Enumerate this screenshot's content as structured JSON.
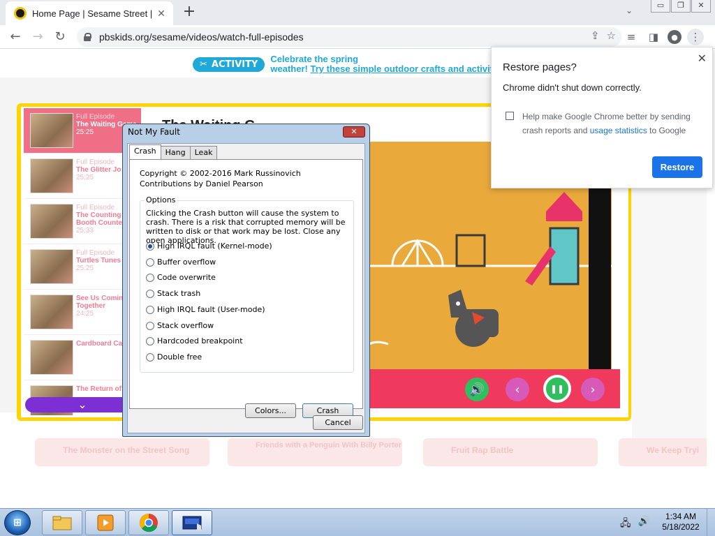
{
  "browser": {
    "tab_title": "Home Page | Sesame Street | PBS",
    "tab_close": "✕",
    "new_tab": "+",
    "tab_menu": "⌄",
    "url": "pbskids.org/sesame/videos/watch-full-episodes",
    "window_buttons": [
      "▭",
      "❐",
      "✕"
    ]
  },
  "banner": {
    "pill": "ACTIVITY",
    "line1": "Celebrate the spring",
    "line2_prefix": "weather!",
    "line2_link": "Try these simple outdoor crafts and activiti"
  },
  "player": {
    "title": "The Waiting G",
    "playlist": [
      {
        "ep": "Full Episode",
        "name": "The Waiting Game",
        "dur": "25:25",
        "active": true
      },
      {
        "ep": "Full Episode",
        "name": "The Glitter Jo",
        "dur": "25:25",
        "active": false
      },
      {
        "ep": "Full Episode",
        "name": "The Counting Booth Counte",
        "dur": "25:33",
        "active": false
      },
      {
        "ep": "Full Episode",
        "name": "Turtles Tunes",
        "dur": "25:25",
        "active": false
      },
      {
        "ep": "",
        "name": "See Us Comin Together",
        "dur": "24:25",
        "active": false
      },
      {
        "ep": "",
        "name": "Cardboard Castle",
        "dur": "",
        "active": false
      },
      {
        "ep": "",
        "name": "The Return of",
        "dur": "",
        "active": false
      }
    ],
    "scroll_down": "⌄",
    "controls": {
      "volume": "🔊",
      "prev": "‹",
      "pause": "❚❚",
      "next": "›"
    },
    "below": [
      {
        "label": "The Monster on the Street Song"
      },
      {
        "label": "Friends with a Penguin With Billy Porter"
      },
      {
        "label": "Fruit Rap Battle"
      },
      {
        "label": "We Keep Tryi"
      }
    ]
  },
  "restore_popup": {
    "title": "Restore pages?",
    "message": "Chrome didn't shut down correctly.",
    "checkbox_text": "Help make Google Chrome better by sending crash reports and",
    "checkbox_link": "usage statistics",
    "checkbox_suffix": "to Google",
    "button": "Restore",
    "close": "✕"
  },
  "dialog": {
    "title": "Not My Fault",
    "close": "✕",
    "tabs": [
      "Crash",
      "Hang",
      "Leak"
    ],
    "active_tab": "Crash",
    "copyright": "Copyright © 2002-2016 Mark Russinovich",
    "contributions": "Contributions by Daniel Pearson",
    "options_legend": "Options",
    "warning": "Clicking the Crash button will cause the system to crash. There is a risk that corrupted memory will be written to disk or that work may be lost. Close any open applications.",
    "radios": [
      {
        "label": "High IRQL fault (Kernel-mode)",
        "selected": true
      },
      {
        "label": "Buffer overflow",
        "selected": false
      },
      {
        "label": "Code overwrite",
        "selected": false
      },
      {
        "label": "Stack trash",
        "selected": false
      },
      {
        "label": "High IRQL fault (User-mode)",
        "selected": false
      },
      {
        "label": "Stack overflow",
        "selected": false
      },
      {
        "label": "Hardcoded breakpoint",
        "selected": false
      },
      {
        "label": "Double free",
        "selected": false
      }
    ],
    "colors_button": "Colors...",
    "crash_button": "Crash",
    "cancel_button": "Cancel"
  },
  "taskbar": {
    "start": "⊞",
    "time": "1:34 AM",
    "date": "5/18/2022"
  },
  "colors": {
    "chrome_blue": "#1a73e8",
    "pbs_yellow": "#ffd400",
    "player_red": "#ef3a5d",
    "active_episode": "#ee6f86"
  }
}
